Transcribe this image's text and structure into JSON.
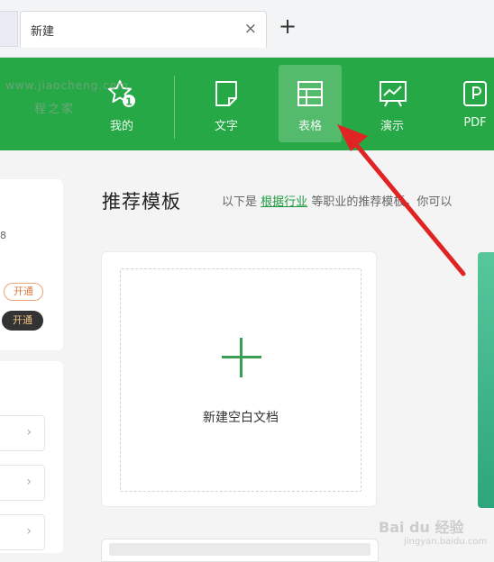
{
  "tabbar": {
    "tab_title": "新建",
    "close_glyph": "×",
    "new_tab_glyph": "+"
  },
  "toolbar": {
    "items": [
      {
        "label": "我的",
        "icon": "star-badge-icon",
        "badge": "1"
      },
      {
        "label": "文字",
        "icon": "document-icon"
      },
      {
        "label": "表格",
        "icon": "spreadsheet-icon",
        "active": true
      },
      {
        "label": "演示",
        "icon": "presentation-icon"
      },
      {
        "label": "PDF",
        "icon": "pdf-icon"
      }
    ],
    "color": "#25a845"
  },
  "left": {
    "number_fragment": "8",
    "watermark_url": "www.jiaocheng.com",
    "watermark_name": "程之家",
    "open_outline_label": "开通",
    "open_filled_label": "开通",
    "chevron": "›"
  },
  "main": {
    "title": "推荐模板",
    "desc_prefix": "以下是",
    "desc_link": "根据行业",
    "desc_suffix": "等职业的推荐模板，你可以",
    "blank_doc_label": "新建空白文档"
  },
  "annotation": {
    "arrow_color": "#e02424"
  },
  "watermark": {
    "brand": "Bai du 经验",
    "sub": "jingyan.baidu.com"
  }
}
